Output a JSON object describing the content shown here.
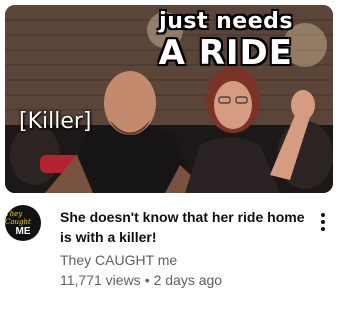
{
  "video": {
    "overlay_line1": "just needs",
    "overlay_line2": "A RIDE",
    "overlay_tag": "[Killer]",
    "title": "She doesn't know that her ride home is with a killer!",
    "channel": "They CAUGHT me",
    "views": "11,771 views",
    "separator": "•",
    "age": "2 days ago"
  },
  "avatar": {
    "line1": "They Caught",
    "line2": "ME"
  },
  "colors": {
    "title": "#0f0f0f",
    "meta": "#606060",
    "avatar_accent": "#f2d21b"
  }
}
